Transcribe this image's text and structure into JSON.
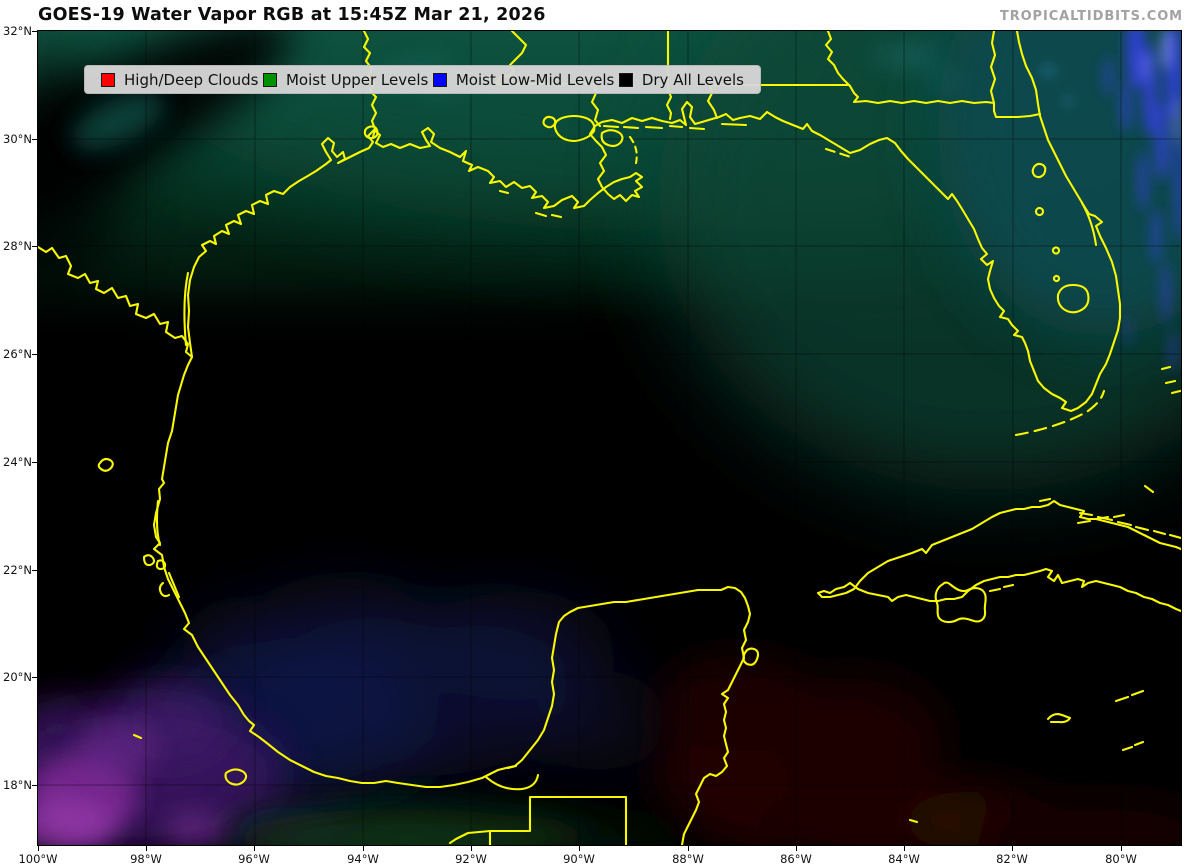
{
  "header": {
    "title": "GOES-19 Water Vapor RGB at 15:45Z Mar 21, 2026",
    "watermark": "TROPICALTIDBITS.COM"
  },
  "legend": {
    "items": [
      {
        "label": "High/Deep Clouds",
        "color": "#ff0000"
      },
      {
        "label": "Moist Upper Levels",
        "color": "#009000"
      },
      {
        "label": "Moist Low-Mid Levels",
        "color": "#0000ff"
      },
      {
        "label": "Dry All Levels",
        "color": "#000000"
      }
    ]
  },
  "axes": {
    "lat_labels": [
      "32°N",
      "30°N",
      "28°N",
      "26°N",
      "24°N",
      "22°N",
      "20°N",
      "18°N"
    ],
    "lon_labels": [
      "100°W",
      "98°W",
      "96°W",
      "94°W",
      "92°W",
      "90°W",
      "88°W",
      "86°W",
      "84°W",
      "82°W",
      "80°W"
    ]
  },
  "map": {
    "colors": {
      "background": "#000000",
      "coastline_yellow": "#f8f800",
      "moist_upper_green": "#10503e",
      "moist_upper_green_mid": "#0a3f2f",
      "atlantic_teal": "#0d4a50",
      "cloud_streak_blue": "#3440e0",
      "low_cloud_navy": "#141b56",
      "low_cloud_purple": "#8a2f9e",
      "dry_warm_red": "#240603",
      "south_green": "#0c3c16",
      "grid_line": "#000000"
    }
  }
}
